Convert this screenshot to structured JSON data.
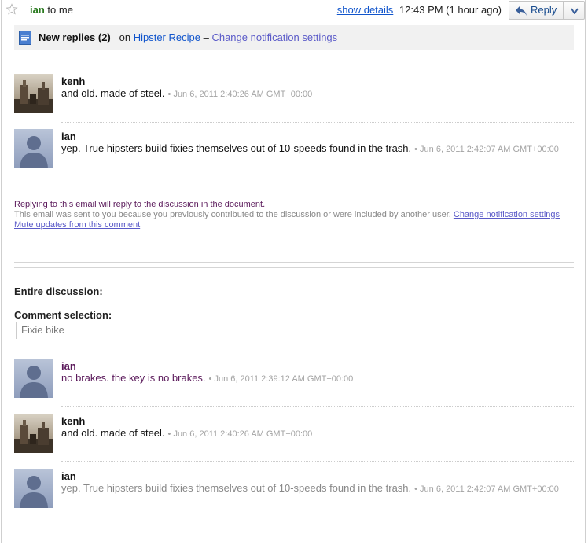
{
  "header": {
    "sender": "ian",
    "recipient": "to me",
    "show_details": "show details",
    "time": "12:43 PM (1 hour ago)",
    "reply_label": "Reply"
  },
  "banner": {
    "title": "New replies (2)",
    "on_text": "on",
    "doc_link": "Hipster Recipe",
    "dash": "–",
    "settings_link": "Change notification settings"
  },
  "new_replies": [
    {
      "author": "kenh",
      "text": "and old. made of steel.",
      "time": "• Jun 6, 2011 2:40:26 AM GMT+00:00",
      "avatar": "photo"
    },
    {
      "author": "ian",
      "text": "yep. True hipsters build fixies themselves out of 10-speeds found in the trash.",
      "time": "• Jun 6, 2011 2:42:07 AM GMT+00:00",
      "avatar": "silhouette"
    }
  ],
  "footer": {
    "line1": "Replying to this email will reply to the discussion in the document.",
    "line2": "This email was sent to you because you previously contributed to the discussion or were included by another user.",
    "line2_link": "Change notification settings",
    "mute_link": "Mute updates from this comment"
  },
  "discussion": {
    "title": "Entire discussion:",
    "selection_label": "Comment selection:",
    "selection_text": "Fixie bike",
    "comments": [
      {
        "author": "ian",
        "text": "no brakes. the key is no brakes.",
        "time": "• Jun 6, 2011 2:39:12 AM GMT+00:00",
        "avatar": "silhouette"
      },
      {
        "author": "kenh",
        "text": "and old. made of steel.",
        "time": "• Jun 6, 2011 2:40:26 AM GMT+00:00",
        "avatar": "photo"
      },
      {
        "author": "ian",
        "text": "yep. True hipsters build fixies themselves out of 10-speeds found in the trash.",
        "time": "• Jun 6, 2011 2:42:07 AM GMT+00:00",
        "avatar": "silhouette"
      }
    ]
  },
  "colors": {
    "link": "#1155cc",
    "sender": "#2a7a1f",
    "purple": "#5b1a5b"
  }
}
